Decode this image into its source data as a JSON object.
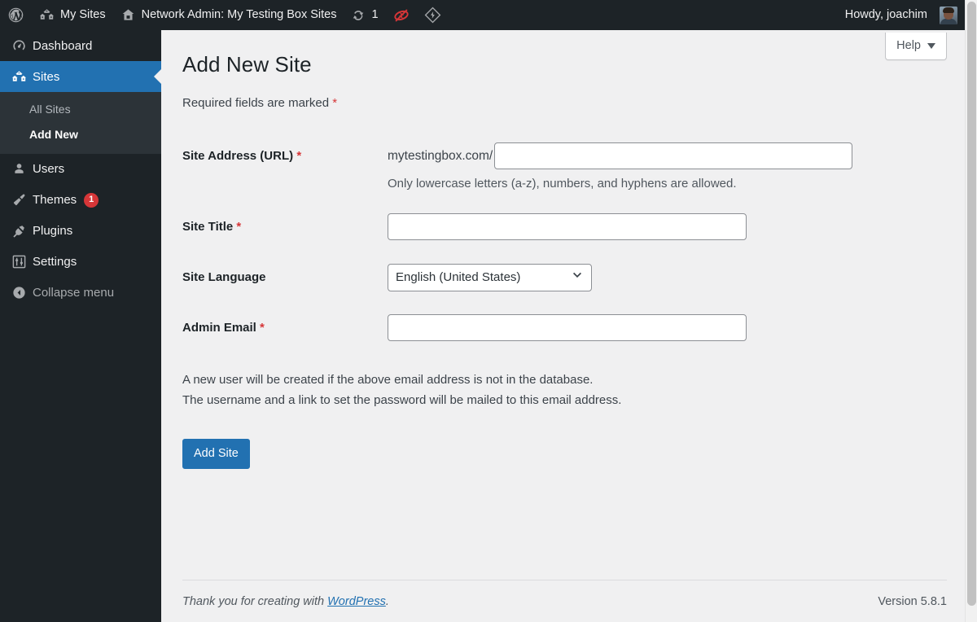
{
  "adminbar": {
    "wp_logo_icon": "wordpress-logo-icon",
    "my_sites_label": "My Sites",
    "my_sites_icon": "multisite-icon",
    "network_admin_label": "Network Admin: My Testing Box Sites",
    "network_admin_icon": "home-icon",
    "updates_icon": "update-refresh-icon",
    "updates_count": "1",
    "jetpack_icon": "jetpack-disabled-icon",
    "extra_icon": "diamond-bolt-icon",
    "howdy_label": "Howdy, joachim",
    "avatar_icon": "user-avatar"
  },
  "sidebar": {
    "items": [
      {
        "label": "Dashboard",
        "icon": "dashboard-icon",
        "current": false
      },
      {
        "label": "Sites",
        "icon": "sites-multisite-icon",
        "current": true
      },
      {
        "label": "Users",
        "icon": "users-icon",
        "current": false
      },
      {
        "label": "Themes",
        "icon": "themes-brush-icon",
        "current": false,
        "badge": "1"
      },
      {
        "label": "Plugins",
        "icon": "plugins-plug-icon",
        "current": false
      },
      {
        "label": "Settings",
        "icon": "settings-sliders-icon",
        "current": false
      }
    ],
    "submenu": [
      {
        "label": "All Sites",
        "current": false
      },
      {
        "label": "Add New",
        "current": true
      }
    ],
    "collapse_label": "Collapse menu",
    "collapse_icon": "collapse-arrow-left-icon"
  },
  "help_tab": {
    "label": "Help",
    "icon": "chevron-down-icon"
  },
  "main": {
    "page_title": "Add New Site",
    "required_note_text": "Required fields are marked ",
    "required_marker": "*",
    "fields": {
      "site_address": {
        "label": "Site Address (URL)",
        "required_marker": "*",
        "prefix": "mytestingbox.com/",
        "value": "",
        "description": "Only lowercase letters (a-z), numbers, and hyphens are allowed."
      },
      "site_title": {
        "label": "Site Title",
        "required_marker": "*",
        "value": ""
      },
      "site_language": {
        "label": "Site Language",
        "selected": "English (United States)",
        "options": [
          "English (United States)"
        ]
      },
      "admin_email": {
        "label": "Admin Email",
        "required_marker": "*",
        "value": ""
      }
    },
    "note_line_1": "A new user will be created if the above email address is not in the database.",
    "note_line_2": "The username and a link to set the password will be mailed to this email address.",
    "submit_label": "Add Site"
  },
  "footer": {
    "thanks_prefix": "Thank you for creating with ",
    "link_label": "WordPress",
    "thanks_suffix": ".",
    "version": "Version 5.8.1"
  },
  "colors": {
    "admin_bar_bg": "#1d2327",
    "sidebar_bg": "#1d2327",
    "submenu_bg": "#2c3338",
    "accent_blue": "#2271b1",
    "required_red": "#d63638",
    "content_bg": "#f0f0f1"
  }
}
